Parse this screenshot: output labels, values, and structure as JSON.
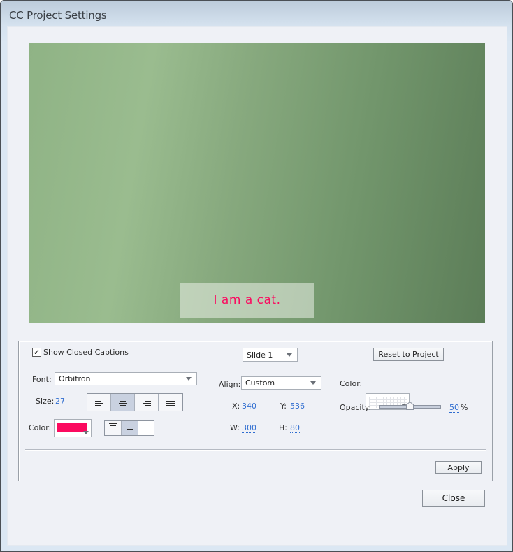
{
  "window": {
    "title": "CC Project Settings"
  },
  "preview": {
    "caption_text": "I am a cat.",
    "caption_color": "#fb0a5f"
  },
  "settings": {
    "show_closed_captions": {
      "label": "Show Closed Captions",
      "checked": true
    },
    "slide_select": {
      "value": "Slide 1"
    },
    "reset_button": {
      "label": "Reset to Project"
    },
    "font": {
      "label": "Font:",
      "value": "Orbitron"
    },
    "size": {
      "label": "Size:",
      "value": "27"
    },
    "text_align": {
      "options": [
        "left",
        "center",
        "right",
        "justify"
      ],
      "selected": "center"
    },
    "text_color": {
      "label": "Color:",
      "value": "#fb0a5f"
    },
    "vertical_align": {
      "options": [
        "top",
        "middle",
        "bottom"
      ],
      "selected": "middle"
    },
    "align": {
      "label": "Align:",
      "value": "Custom"
    },
    "position": {
      "x_label": "X:",
      "x_value": "340",
      "y_label": "Y:",
      "y_value": "536",
      "w_label": "W:",
      "w_value": "300",
      "h_label": "H:",
      "h_value": "80"
    },
    "background_color": {
      "label": "Color:",
      "value": "transparent"
    },
    "opacity": {
      "label": "Opacity:",
      "value": "50",
      "unit": "%",
      "fraction": 0.5
    },
    "apply_button": {
      "label": "Apply"
    }
  },
  "footer": {
    "close_button": {
      "label": "Close"
    }
  }
}
